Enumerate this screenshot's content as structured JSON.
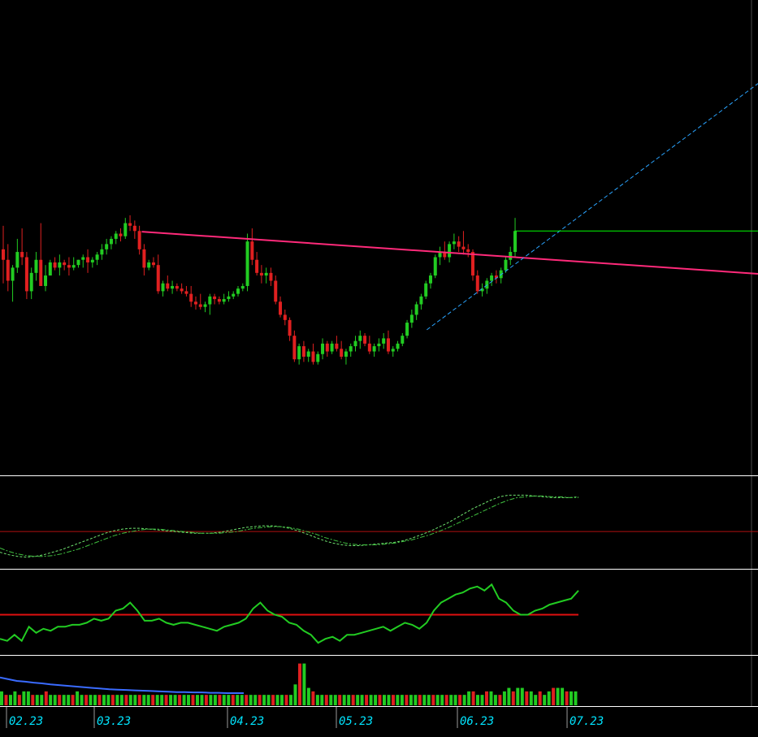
{
  "theme": {
    "background": "#000000",
    "bull_color": "#22cc22",
    "bear_color": "#e02020",
    "divider_color": "#ffffff",
    "resistance_color": "#ff2a7a",
    "support_color": "#2aa4ff",
    "breakout_color": "#00ff00",
    "axis_text_color": "#00e5ff",
    "grid_color": "#4a4a4a"
  },
  "chart_data": [
    {
      "type": "candlestick",
      "panel": "price",
      "x_labels": [
        "02.23",
        "03.23",
        "04.23",
        "05.23",
        "06.23",
        "07.23"
      ],
      "candles": [
        [
          99.6,
          100.5,
          98.3,
          99.2
        ],
        [
          99.2,
          99.8,
          98.0,
          98.4
        ],
        [
          98.4,
          99.0,
          97.6,
          98.9
        ],
        [
          98.9,
          100.0,
          98.7,
          99.5
        ],
        [
          99.5,
          100.4,
          99.0,
          99.3
        ],
        [
          99.3,
          99.5,
          97.7,
          98.0
        ],
        [
          98.0,
          98.9,
          97.7,
          98.7
        ],
        [
          98.7,
          99.5,
          98.4,
          99.2
        ],
        [
          99.2,
          100.6,
          98.2,
          98.2
        ],
        [
          98.2,
          99.0,
          98.0,
          98.6
        ],
        [
          98.6,
          99.2,
          98.6,
          99.1
        ],
        [
          99.1,
          99.3,
          98.8,
          98.9
        ],
        [
          98.9,
          99.4,
          98.6,
          99.1
        ],
        [
          99.1,
          99.2,
          98.8,
          99.0
        ],
        [
          99.0,
          99.3,
          98.6,
          98.9
        ],
        [
          98.9,
          99.3,
          98.8,
          99.0
        ],
        [
          99.0,
          99.2,
          98.9,
          99.2
        ],
        [
          99.2,
          99.4,
          98.9,
          99.3
        ],
        [
          99.3,
          99.6,
          98.7,
          99.1
        ],
        [
          99.1,
          99.3,
          98.9,
          99.2
        ],
        [
          99.2,
          99.5,
          99.0,
          99.4
        ],
        [
          99.4,
          99.8,
          99.2,
          99.6
        ],
        [
          99.6,
          100.0,
          99.4,
          99.8
        ],
        [
          99.8,
          100.1,
          99.6,
          100.0
        ],
        [
          100.0,
          100.3,
          99.8,
          100.2
        ],
        [
          100.2,
          100.4,
          99.9,
          100.1
        ],
        [
          100.1,
          100.8,
          100.0,
          100.6
        ],
        [
          100.6,
          100.9,
          100.3,
          100.5
        ],
        [
          100.5,
          100.7,
          100.0,
          100.3
        ],
        [
          100.3,
          100.5,
          99.4,
          99.6
        ],
        [
          99.6,
          99.8,
          98.6,
          98.9
        ],
        [
          98.9,
          99.2,
          98.8,
          99.1
        ],
        [
          99.1,
          99.3,
          98.9,
          99.0
        ],
        [
          99.0,
          99.4,
          97.9,
          98.0
        ],
        [
          98.0,
          98.4,
          97.8,
          98.3
        ],
        [
          98.3,
          98.6,
          98.0,
          98.1
        ],
        [
          98.1,
          98.4,
          97.9,
          98.2
        ],
        [
          98.2,
          98.3,
          98.0,
          98.1
        ],
        [
          98.1,
          98.3,
          97.9,
          98.0
        ],
        [
          98.0,
          98.2,
          97.8,
          97.9
        ],
        [
          97.9,
          98.2,
          97.4,
          97.6
        ],
        [
          97.6,
          97.8,
          97.3,
          97.5
        ],
        [
          97.5,
          97.9,
          97.3,
          97.4
        ],
        [
          97.4,
          97.6,
          97.2,
          97.5
        ],
        [
          97.5,
          97.9,
          97.1,
          97.8
        ],
        [
          97.8,
          97.9,
          97.5,
          97.7
        ],
        [
          97.7,
          97.8,
          97.5,
          97.6
        ],
        [
          97.6,
          97.9,
          97.5,
          97.7
        ],
        [
          97.7,
          98.0,
          97.6,
          97.8
        ],
        [
          97.8,
          98.0,
          97.7,
          97.9
        ],
        [
          97.9,
          98.2,
          97.8,
          98.1
        ],
        [
          98.1,
          98.3,
          98.0,
          98.2
        ],
        [
          98.2,
          100.2,
          98.0,
          99.9
        ],
        [
          99.9,
          100.4,
          99.0,
          99.2
        ],
        [
          99.2,
          99.5,
          98.6,
          98.7
        ],
        [
          98.7,
          99.0,
          98.3,
          98.6
        ],
        [
          98.6,
          98.9,
          98.3,
          98.7
        ],
        [
          98.7,
          98.9,
          98.2,
          98.4
        ],
        [
          98.4,
          98.6,
          97.5,
          97.6
        ],
        [
          97.6,
          97.8,
          97.0,
          97.1
        ],
        [
          97.1,
          97.3,
          96.7,
          96.9
        ],
        [
          96.9,
          97.0,
          96.1,
          96.3
        ],
        [
          96.3,
          96.5,
          95.3,
          95.4
        ],
        [
          95.4,
          96.0,
          95.2,
          95.9
        ],
        [
          95.9,
          96.1,
          95.3,
          95.5
        ],
        [
          95.5,
          95.8,
          95.3,
          95.7
        ],
        [
          95.7,
          96.0,
          95.2,
          95.3
        ],
        [
          95.3,
          95.7,
          95.2,
          95.6
        ],
        [
          95.6,
          96.2,
          95.4,
          96.0
        ],
        [
          96.0,
          96.1,
          95.5,
          95.7
        ],
        [
          95.7,
          96.1,
          95.6,
          96.0
        ],
        [
          96.0,
          96.3,
          95.7,
          95.8
        ],
        [
          95.8,
          96.1,
          95.4,
          95.5
        ],
        [
          95.5,
          95.8,
          95.2,
          95.7
        ],
        [
          95.7,
          96.0,
          95.5,
          95.9
        ],
        [
          95.9,
          96.3,
          95.7,
          96.1
        ],
        [
          96.1,
          96.5,
          95.8,
          96.3
        ],
        [
          96.3,
          96.4,
          95.9,
          96.0
        ],
        [
          96.0,
          96.3,
          95.6,
          95.7
        ],
        [
          95.7,
          96.0,
          95.5,
          95.9
        ],
        [
          95.9,
          96.2,
          95.7,
          96.0
        ],
        [
          96.0,
          96.4,
          95.8,
          96.2
        ],
        [
          96.2,
          96.5,
          95.6,
          95.7
        ],
        [
          95.7,
          95.9,
          95.5,
          95.8
        ],
        [
          95.8,
          96.1,
          95.7,
          96.0
        ],
        [
          96.0,
          96.4,
          95.9,
          96.3
        ],
        [
          96.3,
          96.9,
          96.2,
          96.8
        ],
        [
          96.8,
          97.3,
          96.6,
          97.1
        ],
        [
          97.1,
          97.6,
          96.9,
          97.5
        ],
        [
          97.5,
          97.9,
          97.3,
          97.8
        ],
        [
          97.8,
          98.4,
          97.7,
          98.3
        ],
        [
          98.3,
          98.7,
          98.1,
          98.6
        ],
        [
          98.6,
          99.4,
          98.5,
          99.3
        ],
        [
          99.3,
          99.7,
          99.0,
          99.5
        ],
        [
          99.5,
          99.9,
          99.2,
          99.3
        ],
        [
          99.3,
          99.9,
          99.1,
          99.8
        ],
        [
          99.8,
          100.2,
          99.6,
          99.9
        ],
        [
          99.9,
          100.1,
          99.5,
          99.7
        ],
        [
          99.7,
          100.3,
          99.4,
          99.6
        ],
        [
          99.6,
          99.8,
          99.3,
          99.5
        ],
        [
          99.5,
          99.6,
          98.4,
          98.6
        ],
        [
          98.6,
          98.8,
          97.9,
          98.0
        ],
        [
          98.0,
          98.3,
          97.8,
          98.1
        ],
        [
          98.1,
          98.5,
          97.9,
          98.4
        ],
        [
          98.4,
          98.7,
          98.2,
          98.6
        ],
        [
          98.6,
          98.8,
          98.3,
          98.5
        ],
        [
          98.5,
          98.9,
          98.3,
          98.8
        ],
        [
          98.8,
          99.3,
          98.7,
          99.2
        ],
        [
          99.2,
          99.7,
          99.0,
          99.5
        ],
        [
          99.5,
          100.8,
          99.3,
          100.3
        ]
      ],
      "resistance_line": {
        "from": [
          3,
          100.6
        ],
        "to": [
          100.8,
          99.4
        ]
      },
      "support_line": {
        "from": [
          81,
          95.3
        ],
        "to": [
          126,
          101.3
        ]
      },
      "breakout_level": 100.3
    },
    {
      "type": "line",
      "panel": "oscillator",
      "series": [
        {
          "values": [
            -0.25,
            -0.28,
            -0.3,
            -0.31,
            -0.3,
            -0.28,
            -0.25,
            -0.22,
            -0.18,
            -0.14,
            -0.1,
            -0.06,
            -0.02,
            0.01,
            0.03,
            0.04,
            0.04,
            0.03,
            0.02,
            0.01,
            0.0,
            -0.01,
            -0.02,
            -0.02,
            -0.02,
            -0.01,
            0.01,
            0.03,
            0.05,
            0.06,
            0.07,
            0.07,
            0.06,
            0.04,
            0.01,
            -0.03,
            -0.07,
            -0.11,
            -0.14,
            -0.16,
            -0.17,
            -0.17,
            -0.16,
            -0.15,
            -0.14,
            -0.13,
            -0.11,
            -0.08,
            -0.04,
            0.0,
            0.05,
            0.1,
            0.16,
            0.22,
            0.28,
            0.33,
            0.38,
            0.42,
            0.44,
            0.44,
            0.44,
            0.43,
            0.42,
            0.41,
            0.41,
            0.41,
            0.42
          ]
        },
        {
          "values": [
            -0.2,
            -0.24,
            -0.27,
            -0.29,
            -0.3,
            -0.3,
            -0.29,
            -0.27,
            -0.24,
            -0.21,
            -0.17,
            -0.13,
            -0.09,
            -0.05,
            -0.02,
            0.0,
            0.02,
            0.03,
            0.03,
            0.02,
            0.01,
            0.0,
            -0.01,
            -0.02,
            -0.02,
            -0.02,
            -0.01,
            0.0,
            0.02,
            0.04,
            0.05,
            0.06,
            0.06,
            0.05,
            0.03,
            0.0,
            -0.03,
            -0.07,
            -0.1,
            -0.13,
            -0.15,
            -0.16,
            -0.16,
            -0.16,
            -0.15,
            -0.14,
            -0.12,
            -0.1,
            -0.07,
            -0.04,
            0.0,
            0.04,
            0.09,
            0.14,
            0.19,
            0.24,
            0.29,
            0.34,
            0.38,
            0.41,
            0.42,
            0.43,
            0.43,
            0.42,
            0.42,
            0.41,
            0.41
          ]
        }
      ],
      "zero_line": 0
    },
    {
      "type": "line",
      "panel": "indicator",
      "reference_line": 50,
      "series": [
        {
          "values": [
            38,
            37,
            40,
            37,
            44,
            41,
            43,
            42,
            44,
            44,
            45,
            45,
            46,
            48,
            47,
            48,
            52,
            53,
            56,
            52,
            47,
            47,
            48,
            46,
            45,
            46,
            46,
            45,
            44,
            43,
            42,
            44,
            45,
            46,
            48,
            53,
            56,
            52,
            50,
            49,
            46,
            45,
            42,
            40,
            36,
            38,
            39,
            37,
            40,
            40,
            41,
            42,
            43,
            44,
            42,
            44,
            46,
            45,
            43,
            46,
            52,
            56,
            58,
            60,
            61,
            63,
            64,
            62,
            65,
            58,
            56,
            52,
            50,
            50,
            52,
            53,
            55,
            56,
            57,
            58,
            62
          ]
        }
      ]
    },
    {
      "type": "bar",
      "panel": "volume",
      "values": [
        4,
        3,
        3,
        4,
        3,
        4,
        4,
        3,
        3,
        3,
        4,
        3,
        3,
        3,
        3,
        3,
        3,
        4,
        3,
        3,
        3,
        3,
        3,
        3,
        3,
        3,
        3,
        3,
        3,
        3,
        3,
        3,
        3,
        3,
        3,
        3,
        3,
        3,
        3,
        3,
        3,
        3,
        3,
        3,
        3,
        3,
        3,
        3,
        3,
        3,
        3,
        3,
        3,
        3,
        3,
        3,
        3,
        3,
        3,
        3,
        3,
        3,
        3,
        3,
        3,
        3,
        6,
        12,
        12,
        5,
        4,
        3,
        3,
        3,
        3,
        3,
        3,
        3,
        3,
        3,
        3,
        3,
        3,
        3,
        3,
        3,
        3,
        3,
        3,
        3,
        3,
        3,
        3,
        3,
        3,
        3,
        3,
        3,
        3,
        3,
        3,
        3,
        3,
        3,
        3,
        4,
        4,
        3,
        3,
        4,
        4,
        3,
        3,
        4,
        5,
        4,
        5,
        5,
        4,
        4,
        3,
        4,
        3,
        4,
        5,
        5,
        5,
        4,
        4,
        4
      ],
      "moving_average": [
        8,
        7.5,
        7,
        6.8,
        6.5,
        6.3,
        6,
        5.8,
        5.6,
        5.4,
        5.2,
        5.0,
        4.8,
        4.6,
        4.5,
        4.4,
        4.3,
        4.2,
        4.1,
        4.0,
        3.9,
        3.8,
        3.8,
        3.7,
        3.7,
        3.6,
        3.6,
        3.5,
        3.5,
        3.5
      ]
    }
  ]
}
